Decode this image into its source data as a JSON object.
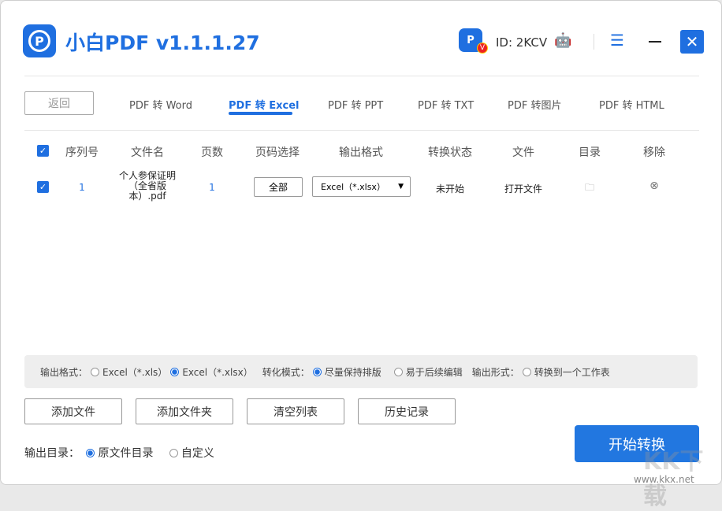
{
  "app": {
    "title": "小白PDF v1.1.1.27",
    "logo_letter": "P",
    "user_id": "ID: 2KCV",
    "vip_badge": "V",
    "menu_icon": "☰",
    "close_icon": "✕"
  },
  "nav": {
    "back": "返回",
    "tabs": [
      {
        "label": "PDF 转 Word"
      },
      {
        "label": "PDF 转 Excel",
        "active": true
      },
      {
        "label": "PDF 转 PPT"
      },
      {
        "label": "PDF 转 TXT"
      },
      {
        "label": "PDF 转图片"
      },
      {
        "label": "PDF 转 HTML"
      }
    ]
  },
  "table": {
    "headers": [
      "序列号",
      "文件名",
      "页数",
      "页码选择",
      "输出格式",
      "转换状态",
      "文件",
      "目录",
      "移除"
    ],
    "rows": [
      {
        "index": "1",
        "filename": "个人参保证明（全省版本）.pdf",
        "pages": "1",
        "page_select": "全部",
        "format": "Excel（*.xlsx）",
        "status": "未开始",
        "file_action": "打开文件"
      }
    ]
  },
  "options": {
    "format_label": "输出格式：",
    "format_xls": "Excel（*.xls）",
    "format_xlsx": "Excel（*.xlsx）",
    "mode_label": "转化模式：",
    "mode_keep": "尽量保持排版",
    "mode_edit": "易于后续编辑",
    "form_label": "输出形式：",
    "form_one_sheet": "转换到一个工作表"
  },
  "buttons": {
    "add_file": "添加文件",
    "add_folder": "添加文件夹",
    "clear": "清空列表",
    "history": "历史记录",
    "start": "开始转换"
  },
  "output": {
    "label": "输出目录：",
    "original": "原文件目录",
    "custom": "自定义"
  },
  "watermark": {
    "logo": "KK下载",
    "url": "www.kkx.net"
  },
  "colors": {
    "accent": "#1f6fe0"
  }
}
